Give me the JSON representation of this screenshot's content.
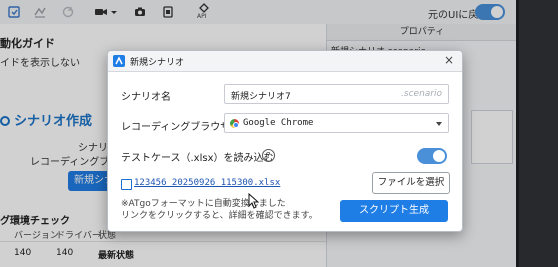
{
  "toolbar": {
    "icons": [
      "record-icon",
      "replay-icon",
      "refresh-icon",
      "video-icon",
      "chevron-down-icon",
      "camera-icon",
      "document-icon",
      "api-icon"
    ],
    "api_label": "API",
    "restore_label": "元のUIに戻す",
    "restore_toggle": "on"
  },
  "properties": {
    "header": "プロパティ",
    "row": "新規シナリオ.scenario"
  },
  "left": {
    "title": "動化ガイド",
    "subtitle": "イドを表示しない",
    "create_heading": "シナリオ作成",
    "step_line1": "シナリ",
    "step_line2": "レコーディングブラ",
    "new_button": "新規シナリ",
    "env_heading": "グ環境チェック",
    "columns": [
      "バージョン",
      "ドライバー",
      "状態"
    ],
    "row": [
      "140",
      "140",
      "最新状態"
    ]
  },
  "dialog": {
    "title": "新規シナリオ",
    "close": "×",
    "scenario_label": "シナリオ名",
    "scenario_value": "新規シナリオ7",
    "scenario_suffix": ".scenario",
    "browser_label": "レコーディングブラウザ",
    "browser_value": "Google Chrome",
    "testcase_label": "テストケース（.xlsx）を読み込む",
    "help": "?",
    "testcase_toggle": "on",
    "file_name": "123456_20250926_115300.xlsx",
    "file_button": "ファイルを選択",
    "note_line1": "※ATgoフォーマットに自動変換しました",
    "note_line2": "リンクをクリックすると、詳細を確認できます。",
    "generate_button": "スクリプト生成"
  },
  "colors": {
    "accent": "#1f7de6",
    "toggle": "#4a90d9",
    "link": "#1d55b3"
  }
}
